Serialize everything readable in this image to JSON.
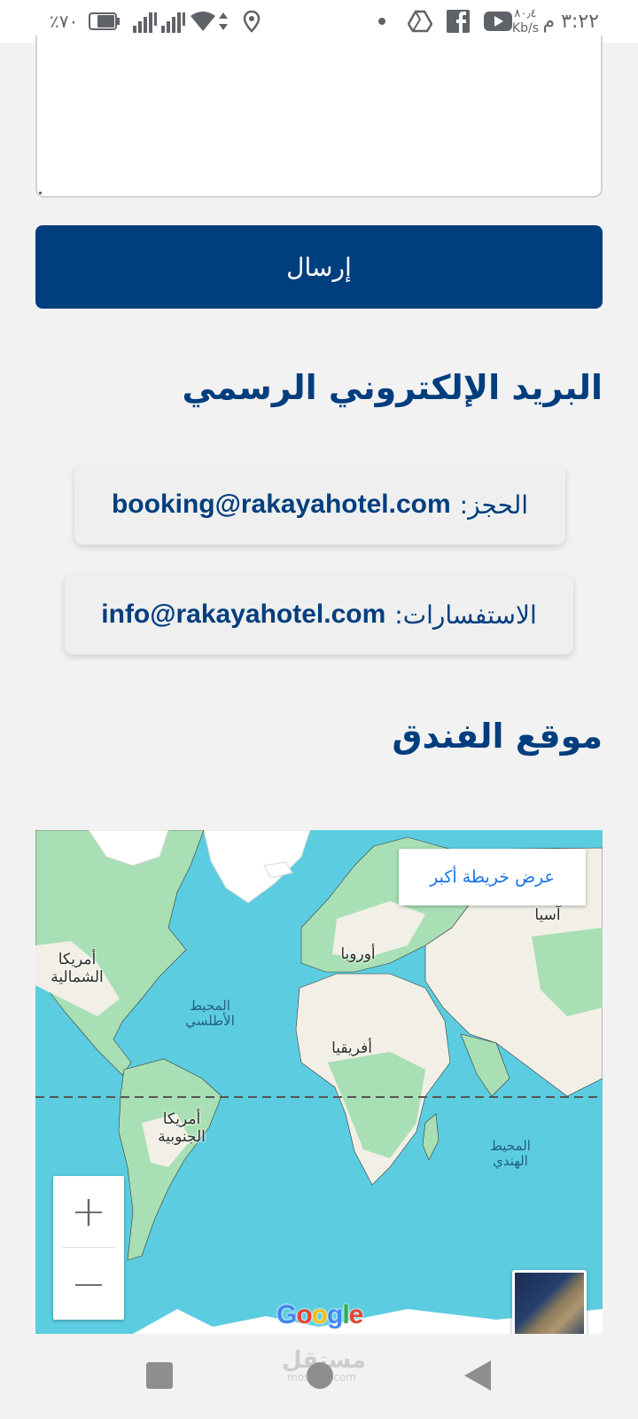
{
  "status_bar": {
    "time": "٣:٢٢ م",
    "speed_value": "٨٠٫٤",
    "speed_unit": "Kb/s",
    "battery": "٪٧٠",
    "icons": [
      "drive-icon",
      "facebook-icon",
      "youtube-icon",
      "dot-icon",
      "location-icon",
      "data-arrows-icon",
      "wifi-icon",
      "signal-icon",
      "battery-icon"
    ]
  },
  "form": {
    "message_value": "",
    "send_label": "إرسال"
  },
  "email_section": {
    "title": "البريد الإلكتروني الرسمي",
    "booking": {
      "label": "الحجز:",
      "email": "booking@rakayahotel.com"
    },
    "inquiries": {
      "label": "الاستفسارات:",
      "email": "info@rakayahotel.com"
    }
  },
  "location_section": {
    "title": "موقع الفندق"
  },
  "map": {
    "larger_map_label": "عرض خريطة أكبر",
    "zoom_in": "+",
    "zoom_out": "−",
    "logo": [
      "G",
      "o",
      "o",
      "g",
      "l",
      "e"
    ],
    "logo_colors": [
      "#4285f4",
      "#ea4335",
      "#fbbc05",
      "#4285f4",
      "#34a853",
      "#ea4335"
    ],
    "labels": {
      "north_america": "أمريكا الشمالية",
      "south_america": "أمريكا الجنوبية",
      "europe": "أوروبا",
      "africa": "أفريقيا",
      "asia": "آسيا",
      "atlantic": "المحيط الأطلسي",
      "indian": "المحيط الهندي"
    },
    "colors": {
      "ocean": "#5ccde0",
      "land": "#f1efe6",
      "green": "#a8dfb4",
      "ice": "#ffffff"
    }
  },
  "watermark": {
    "text": "مستقل",
    "sub": "mostaql.com"
  }
}
